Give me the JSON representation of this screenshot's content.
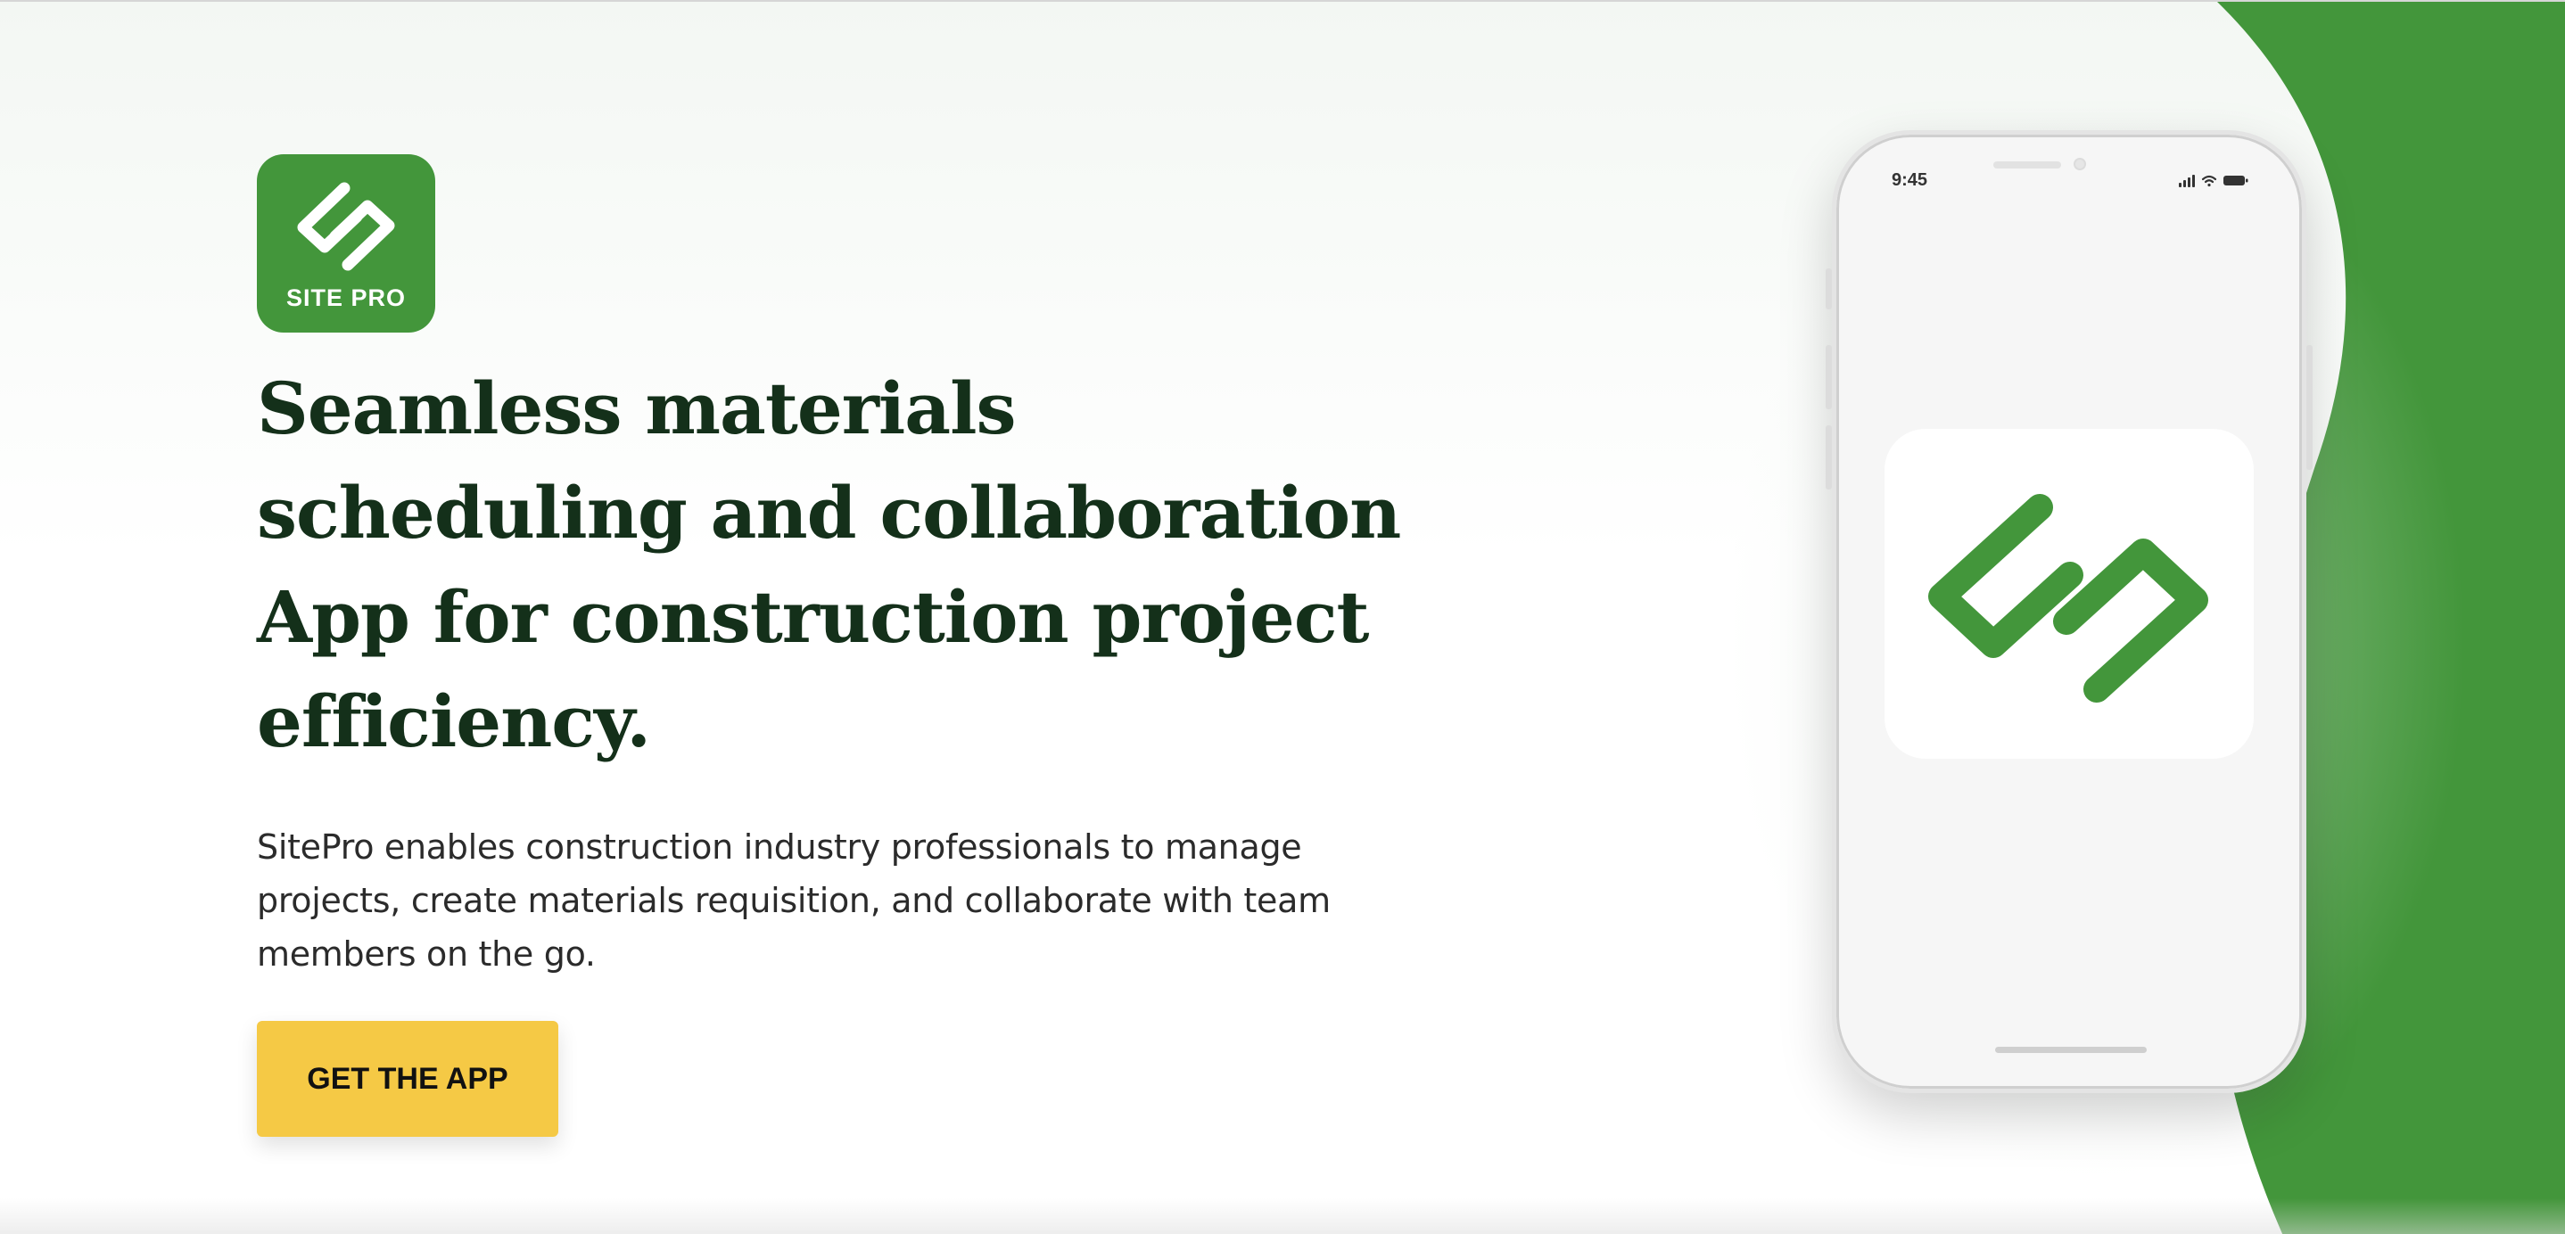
{
  "brand": {
    "logo_text": "SITE PRO",
    "accent_color": "#43963b",
    "dark_text_color": "#14301a",
    "cta_color": "#f5c945"
  },
  "hero": {
    "headline": "Seamless materials scheduling and collaboration App for construction project efficiency.",
    "description": "SitePro enables construction industry professionals to manage projects, create materials requisition, and collaborate with team members on the go.",
    "cta_label": "GET THE APP"
  },
  "phone": {
    "status_time": "9:45",
    "status_icons": [
      "signal-icon",
      "wifi-icon",
      "battery-icon"
    ],
    "app_icon": "sitepro-logo-icon"
  }
}
